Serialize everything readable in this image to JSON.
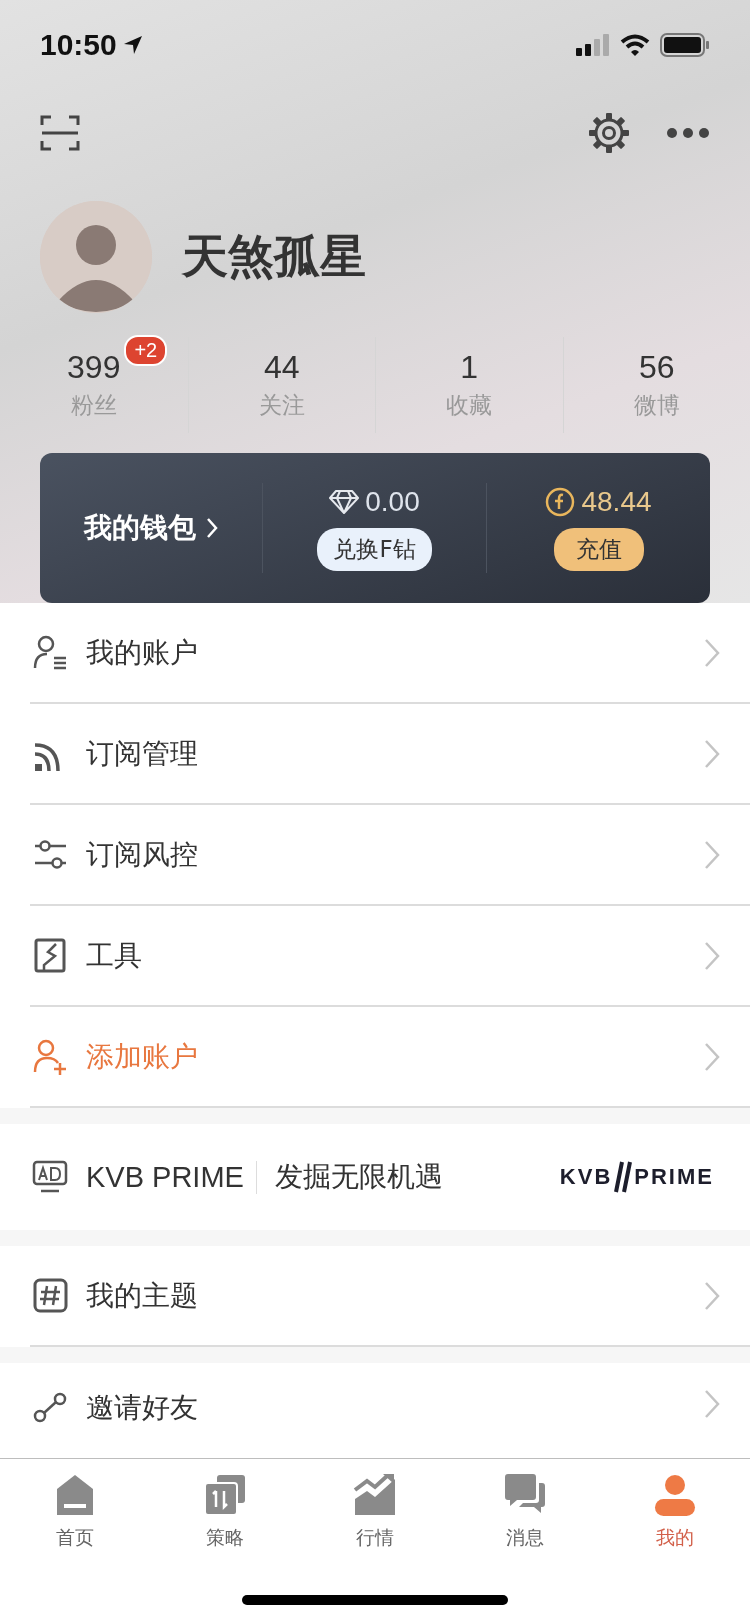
{
  "status_bar": {
    "time": "10:50"
  },
  "profile": {
    "name": "天煞孤星"
  },
  "stats": [
    {
      "value": "399",
      "label": "粉丝",
      "badge": "+2"
    },
    {
      "value": "44",
      "label": "关注"
    },
    {
      "value": "1",
      "label": "收藏"
    },
    {
      "value": "56",
      "label": "微博"
    }
  ],
  "wallet": {
    "title": "我的钱包",
    "items": [
      {
        "kind": "diamond",
        "amount": "0.00",
        "action": "兑换F钻"
      },
      {
        "kind": "coin",
        "amount": "48.44",
        "action": "充值"
      }
    ]
  },
  "menu": [
    {
      "kind": "account",
      "label": "我的账户",
      "accent": false
    },
    {
      "kind": "subscription",
      "label": "订阅管理",
      "accent": false
    },
    {
      "kind": "risk",
      "label": "订阅风控",
      "accent": false
    },
    {
      "kind": "tools",
      "label": "工具",
      "accent": false
    },
    {
      "kind": "add_account",
      "label": "添加账户",
      "accent": true
    }
  ],
  "ad": {
    "title": "KVB PRIME",
    "tagline": "发掘无限机遇",
    "logo_left": "KVB",
    "logo_right": "PRIME"
  },
  "menu_2": [
    {
      "kind": "topic",
      "label": "我的主题"
    }
  ],
  "menu_3": [
    {
      "kind": "invite",
      "label": "邀请好友"
    }
  ],
  "tabs": [
    {
      "kind": "home",
      "label": "首页",
      "selected": false
    },
    {
      "kind": "strategy",
      "label": "策略",
      "selected": false
    },
    {
      "kind": "market",
      "label": "行情",
      "selected": false
    },
    {
      "kind": "messages",
      "label": "消息",
      "selected": false
    },
    {
      "kind": "me",
      "label": "我的",
      "selected": true
    }
  ]
}
